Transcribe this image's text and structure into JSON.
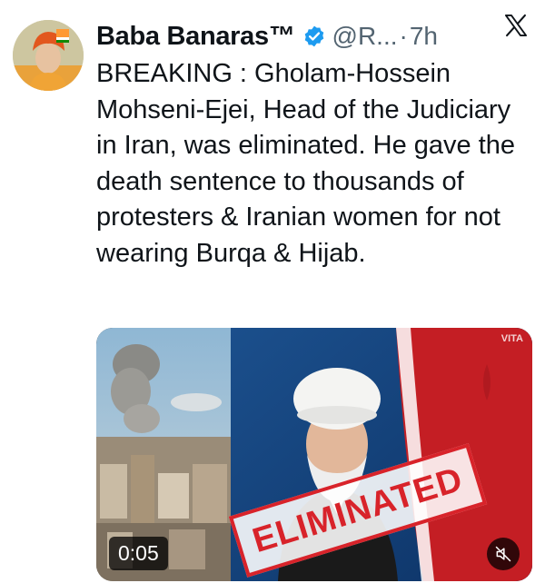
{
  "author": {
    "name": "Baba Banaras™",
    "handle": "@R...",
    "separator": "·",
    "time": "7h",
    "verified_color": "#1d9bf0"
  },
  "tweet": {
    "text": "BREAKING : Gholam-Hossein Mohseni-Ejei, Head of the Judiciary in Iran, was eliminated. He gave the death sentence to thousands of protesters & Iranian women for not wearing Burqa & Hijab."
  },
  "media": {
    "stamp": "ELIMINATED",
    "duration": "0:05",
    "watermark": "VITA",
    "stamp_color": "#d8232a"
  },
  "icons": {
    "avatar": "avatar-image",
    "verified": "verified-badge-icon",
    "platform": "x-logo-icon",
    "mute": "muted-speaker-icon"
  }
}
